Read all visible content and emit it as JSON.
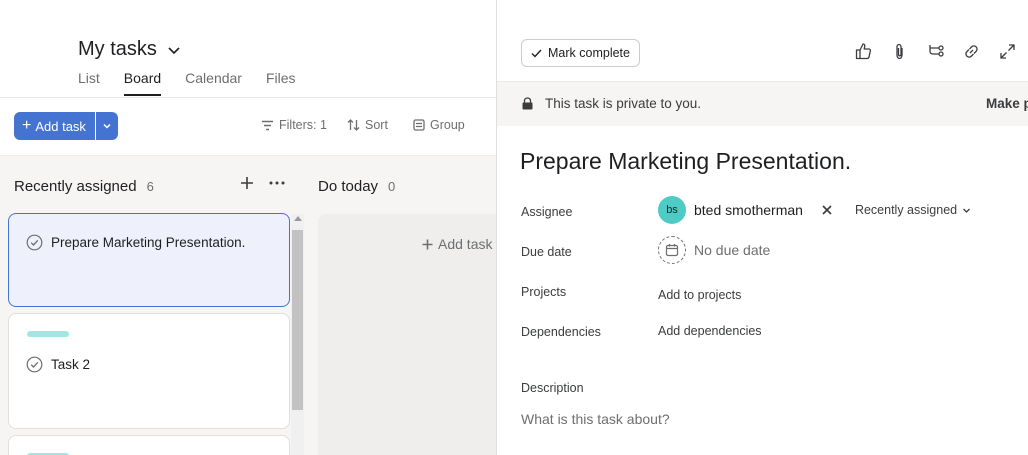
{
  "header": {
    "title": "My tasks",
    "tabs": [
      {
        "label": "List",
        "active": false
      },
      {
        "label": "Board",
        "active": true
      },
      {
        "label": "Calendar",
        "active": false
      },
      {
        "label": "Files",
        "active": false
      }
    ]
  },
  "toolbar": {
    "add_task_label": "Add task",
    "filters_label": "Filters: 1",
    "sort_label": "Sort",
    "group_label": "Group"
  },
  "board": {
    "columns": [
      {
        "title": "Recently assigned",
        "count": "6",
        "cards": [
          {
            "title": "Prepare Marketing Presentation.",
            "selected": true
          },
          {
            "title": "Task 2",
            "tag_color": "#9ee7e3"
          }
        ]
      },
      {
        "title": "Do today",
        "count": "0",
        "add_task_label": "Add task"
      }
    ]
  },
  "task_pane": {
    "mark_complete_label": "Mark complete",
    "private_notice": "This task is private to you.",
    "make_public_label": "Make p",
    "title": "Prepare Marketing Presentation.",
    "fields": {
      "assignee_label": "Assignee",
      "assignee_initials": "bs",
      "assignee_name": "bted smotherman",
      "assignee_section": "Recently assigned",
      "due_date_label": "Due date",
      "due_date_value": "No due date",
      "projects_label": "Projects",
      "projects_value": "Add to projects",
      "dependencies_label": "Dependencies",
      "dependencies_value": "Add dependencies",
      "description_label": "Description",
      "description_placeholder": "What is this task about?"
    },
    "icons": [
      "thumbs-up-icon",
      "paperclip-icon",
      "subtask-icon",
      "link-icon",
      "expand-icon"
    ]
  },
  "colors": {
    "accent": "#4573d2",
    "avatar": "#4ecbc4",
    "tag": "#9ee7e3",
    "selected_card_bg": "#eef0fb"
  }
}
